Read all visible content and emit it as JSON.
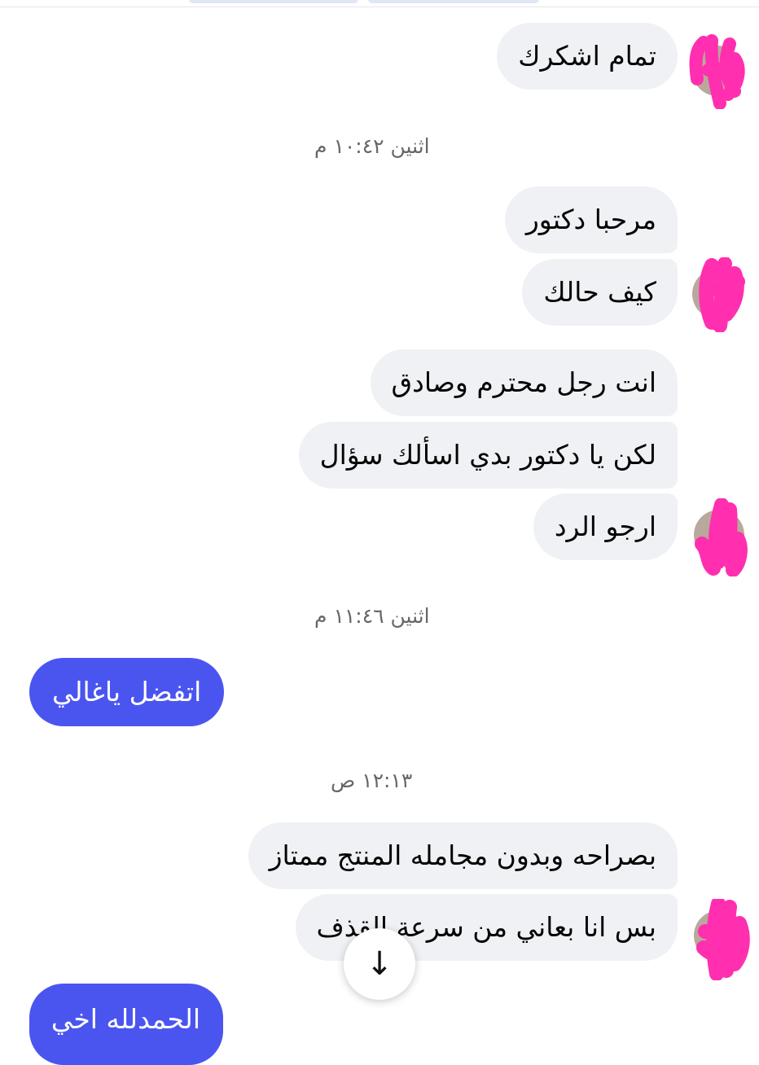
{
  "messages": {
    "m1": "تمام اشكرك",
    "m2": "مرحبا دكتور",
    "m3": "كيف حالك",
    "m4": "انت رجل محترم وصادق",
    "m5": "لكن يا دكتور بدي اسألك سؤال",
    "m6": "ارجو الرد",
    "m7": "اتفضل ياغالي",
    "m8": "بصراحه وبدون مجامله المنتج ممتاز",
    "m9": "بس انا بعاني من سرعة القذف",
    "m10": "الحمدلله اخي"
  },
  "timestamps": {
    "t1": "اثنين ١٠:٤٢ م",
    "t2": "اثنين ١١:٤٦ م",
    "t3": "١٢:١٣ ص"
  },
  "icons": {
    "scroll_down": "↓"
  },
  "colors": {
    "incoming_bubble": "#f0f1f4",
    "outgoing_bubble": "#4a55f0",
    "redaction_mark": "#ff2fb0"
  }
}
